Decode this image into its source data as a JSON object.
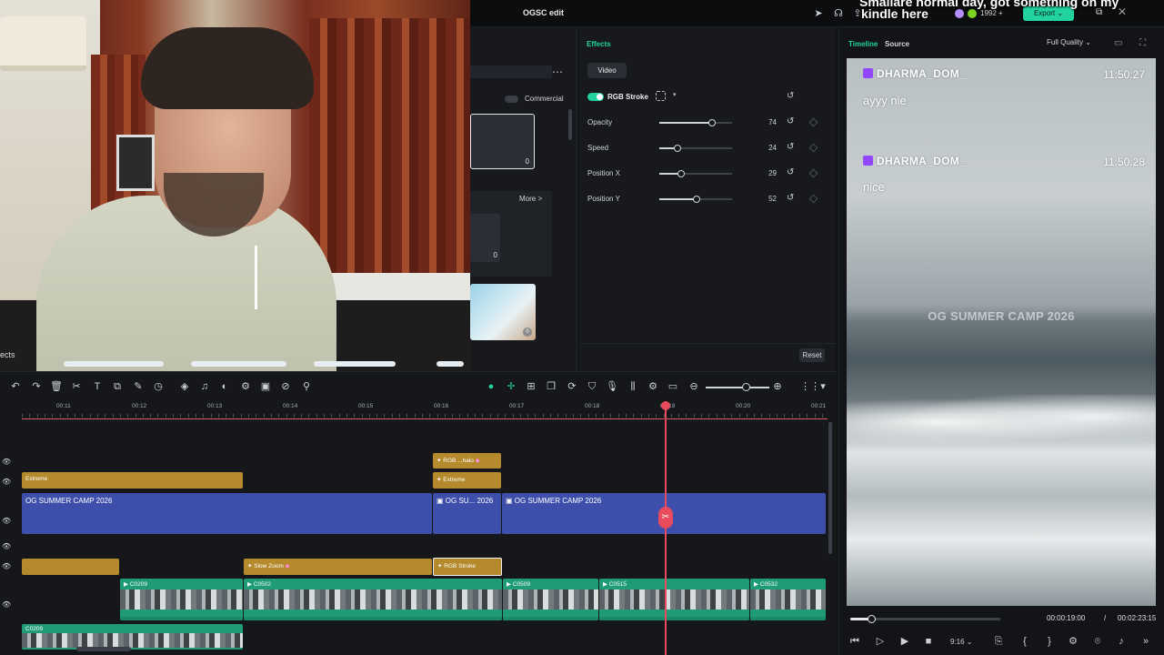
{
  "overlay": {
    "line1": "Smallare normal day, got something on my",
    "line2": "kindle here"
  },
  "webcam": {
    "caption": "ects"
  },
  "topbar": {
    "project_title": "OGSC edit",
    "credits": "1992",
    "export_label": "Export"
  },
  "media": {
    "commercial_label": "Commercial",
    "card1_count": "0",
    "more_label": "More >",
    "card2_count": "0",
    "card3_count": "0"
  },
  "effects": {
    "header": "Effects",
    "subtab": "Video",
    "effect_name": "RGB Stroke",
    "enabled": true,
    "params": [
      {
        "label": "Opacity",
        "value": 74,
        "level": 0.72
      },
      {
        "label": "Speed",
        "value": 24,
        "level": 0.25
      },
      {
        "label": "Position X",
        "value": 29,
        "level": 0.3
      },
      {
        "label": "Position Y",
        "value": 52,
        "level": 0.51
      }
    ],
    "reset_label": "Reset"
  },
  "player": {
    "tab_timeline": "Timeline",
    "tab_source": "Source",
    "quality": "Full Quality",
    "chat": [
      {
        "user": "DHARMA_DOM_",
        "time": "11:50:27",
        "message": "ayyy nie"
      },
      {
        "user": "DHARMA_DOM_",
        "time": "11:50:28",
        "message": "nice"
      }
    ],
    "watermark": "OG SUMMER CAMP 2026",
    "current_time": "00:00:19:00",
    "separator": "/",
    "total_time": "00:02:23:15",
    "progress": 0.14,
    "ratio": "9:16"
  },
  "timeline": {
    "ruler_labels": [
      "00:11",
      "00:12",
      "00:13",
      "00:14",
      "00:15",
      "00:16",
      "00:17",
      "00:18",
      "00:19",
      "00:20",
      "00:21"
    ],
    "clips": {
      "rgb_halo": "RGB ...halo",
      "extreme_top": "Extreme",
      "extreme_left": "Extreme",
      "title_main": "OG SUMMER CAMP 2026",
      "title_mid": "OG SU... 2026",
      "title_right": "OG SUMMER CAMP 2026",
      "slow_zoom": "Slow Zoom",
      "rgb_stroke": "RGB Stroke",
      "v1": "C0209",
      "v2": "C0502",
      "v3": "C0509",
      "v4": "C0515",
      "v5": "C0532",
      "v6": "C0209"
    }
  },
  "colors": {
    "accent": "#22d3a0",
    "playhead": "#e84b5b",
    "title_clip": "#3d4eab",
    "effect_clip": "#b48a2c",
    "video_clip": "#1f9b78"
  }
}
